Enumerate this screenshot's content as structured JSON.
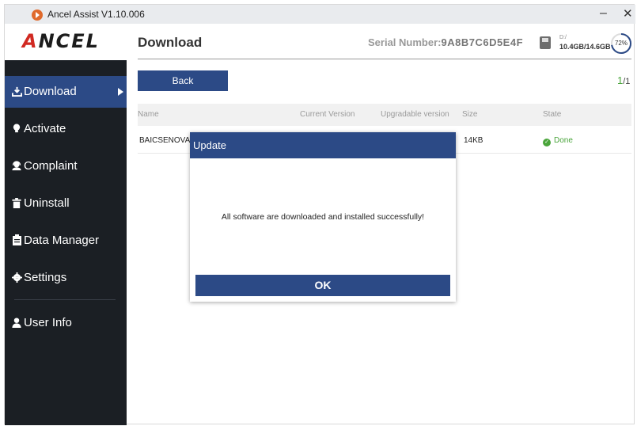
{
  "window": {
    "title": "Ancel Assist  V1.10.006",
    "minimize_symbol": "–",
    "close_symbol": "✕"
  },
  "brand": {
    "logo_text": "ANCEL",
    "accent": "#d12a22"
  },
  "sidebar": {
    "items": [
      {
        "label": "Download",
        "icon": "download-icon",
        "active": true
      },
      {
        "label": "Activate",
        "icon": "bulb-icon"
      },
      {
        "label": "Complaint",
        "icon": "support-agent-icon"
      },
      {
        "label": "Uninstall",
        "icon": "trash-icon"
      },
      {
        "label": "Data Manager",
        "icon": "clipboard-icon"
      },
      {
        "label": "Settings",
        "icon": "gear-icon"
      },
      {
        "label": "User Info",
        "icon": "user-icon"
      }
    ]
  },
  "header": {
    "title": "Download",
    "serial_label": "Serial Number:",
    "serial_value": "9A8B7C6D5E4F",
    "drive": "D:/",
    "storage": "10.4GB/14.6GB",
    "usage": "72%",
    "usage_fraction": 0.72
  },
  "toolbar": {
    "back_label": "Back"
  },
  "pagination": {
    "current": "1",
    "total": "/1"
  },
  "table": {
    "columns": [
      "Name",
      "Current Version",
      "Upgradable version",
      "Size",
      "State"
    ],
    "rows": [
      {
        "name": "BAICSENOVA",
        "current": "",
        "upgradable": "",
        "size": "14KB",
        "state": "Done"
      }
    ]
  },
  "dialog": {
    "title": "Update",
    "message": "All software are downloaded and installed successfully!",
    "ok_label": "OK"
  },
  "colors": {
    "primary": "#2c4a86",
    "sidebar_bg": "#1b1f24",
    "success": "#4aa53b"
  }
}
